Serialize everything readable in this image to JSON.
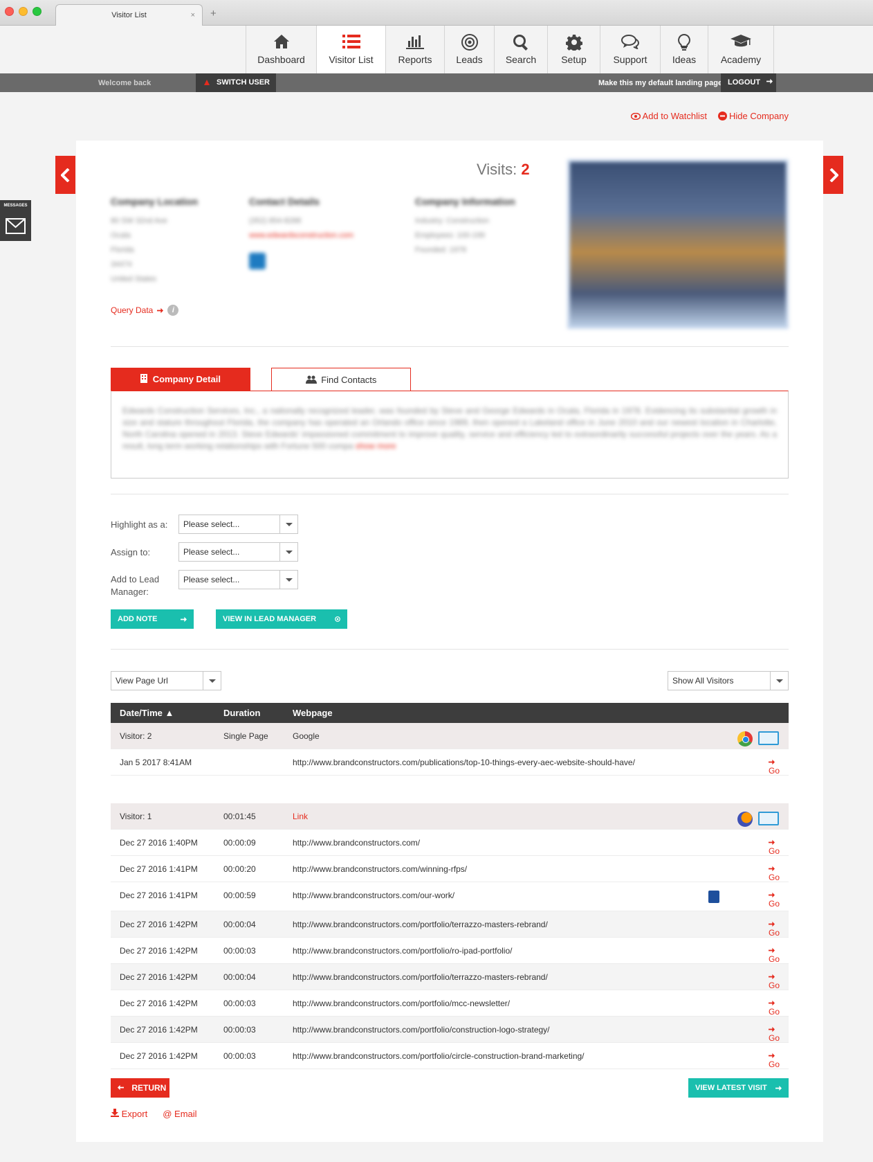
{
  "browser": {
    "tab_title": "Visitor List",
    "close_symbol": "×",
    "new_tab_symbol": "+"
  },
  "nav": {
    "items": [
      {
        "label": "Dashboard",
        "icon": "home-icon"
      },
      {
        "label": "Visitor List",
        "icon": "list-icon",
        "active": true
      },
      {
        "label": "Reports",
        "icon": "bar-chart-icon"
      },
      {
        "label": "Leads",
        "icon": "target-icon"
      },
      {
        "label": "Search",
        "icon": "search-icon"
      },
      {
        "label": "Setup",
        "icon": "gear-icon"
      },
      {
        "label": "Support",
        "icon": "chat-icon"
      },
      {
        "label": "Ideas",
        "icon": "lightbulb-icon"
      },
      {
        "label": "Academy",
        "icon": "graduation-cap-icon"
      }
    ]
  },
  "welcome_bar": {
    "welcome": "Welcome back",
    "switch_user": "SWITCH USER",
    "default_landing": "Make this my default landing page",
    "logout": "LOGOUT"
  },
  "actions": {
    "watchlist": "Add to Watchlist",
    "hide": "Hide Company"
  },
  "messages": {
    "label": "MESSAGES"
  },
  "company": {
    "visits_label": "Visits:",
    "visits_count": "2",
    "location_heading": "Company Location",
    "location_lines": [
      "80 SW 32nd Ave",
      "Ocala",
      "Florida",
      "34474",
      "United States"
    ],
    "contact_heading": "Contact Details",
    "phone": "(352) 854-8288",
    "website": "www.edwardsconstruction.com",
    "info_heading": "Company Information",
    "industry": "Industry: Construction",
    "employees": "Employees: 100-199",
    "founded": "Founded: 1978",
    "query_data": "Query Data",
    "info_symbol": "i"
  },
  "tabs": {
    "company_detail": "Company Detail",
    "find_contacts": "Find Contacts",
    "description": "Edwards Construction Services, Inc., a nationally recognized leader, was founded by Steve and George Edwards in Ocala, Florida in 1978. Evidencing its substantial growth in size and stature throughout Florida, the company has operated an Orlando office since 1989, then opened a Lakeland office in June 2010 and our newest location in Charlotte, North Carolina opened in 2013. Steve Edwards' impassioned commitment to improve quality, service and efficiency led to extraordinarily successful projects over the years. As a result, long term working relationships with Fortune 500 compa",
    "show_more": "show more"
  },
  "form": {
    "highlight_label": "Highlight as a:",
    "assign_label": "Assign to:",
    "lead_label_1": "Add to Lead",
    "lead_label_2": "Manager:",
    "select_placeholder": "Please select...",
    "add_note": "ADD NOTE",
    "view_lead_manager": "VIEW IN LEAD MANAGER"
  },
  "filters": {
    "view_page": "View Page Url",
    "show_visitors": "Show All Visitors"
  },
  "table": {
    "headers": {
      "datetime": "Date/Time ▲",
      "duration": "Duration",
      "webpage": "Webpage"
    },
    "go_label": "Go",
    "visitor2": {
      "label": "Visitor: 2",
      "duration": "Single Page",
      "source": "Google"
    },
    "visitor2_rows": [
      {
        "date": "Jan 5 2017 8:41AM",
        "duration": "",
        "url": "http://www.brandconstructors.com/publications/top-10-things-every-aec-website-should-have/"
      }
    ],
    "visitor1": {
      "label": "Visitor: 1",
      "duration": "00:01:45",
      "source": "Link"
    },
    "visitor1_rows": [
      {
        "date": "Dec 27 2016 1:40PM",
        "duration": "00:00:09",
        "url": "http://www.brandconstructors.com/"
      },
      {
        "date": "Dec 27 2016 1:41PM",
        "duration": "00:00:20",
        "url": "http://www.brandconstructors.com/winning-rfps/"
      },
      {
        "date": "Dec 27 2016 1:41PM",
        "duration": "00:00:59",
        "url": "http://www.brandconstructors.com/our-work/"
      },
      {
        "date": "Dec 27 2016 1:42PM",
        "duration": "00:00:04",
        "url": "http://www.brandconstructors.com/portfolio/terrazzo-masters-rebrand/"
      },
      {
        "date": "Dec 27 2016 1:42PM",
        "duration": "00:00:03",
        "url": "http://www.brandconstructors.com/portfolio/ro-ipad-portfolio/"
      },
      {
        "date": "Dec 27 2016 1:42PM",
        "duration": "00:00:04",
        "url": "http://www.brandconstructors.com/portfolio/terrazzo-masters-rebrand/"
      },
      {
        "date": "Dec 27 2016 1:42PM",
        "duration": "00:00:03",
        "url": "http://www.brandconstructors.com/portfolio/mcc-newsletter/"
      },
      {
        "date": "Dec 27 2016 1:42PM",
        "duration": "00:00:03",
        "url": "http://www.brandconstructors.com/portfolio/construction-logo-strategy/"
      },
      {
        "date": "Dec 27 2016 1:42PM",
        "duration": "00:00:03",
        "url": "http://www.brandconstructors.com/portfolio/circle-construction-brand-marketing/"
      }
    ]
  },
  "bottom": {
    "return": "RETURN",
    "view_latest": "VIEW LATEST VISIT",
    "export": "Export",
    "email": "Email"
  },
  "colors": {
    "accent": "#e52b1e",
    "teal": "#1abfae",
    "dark": "#3d3d3d"
  }
}
